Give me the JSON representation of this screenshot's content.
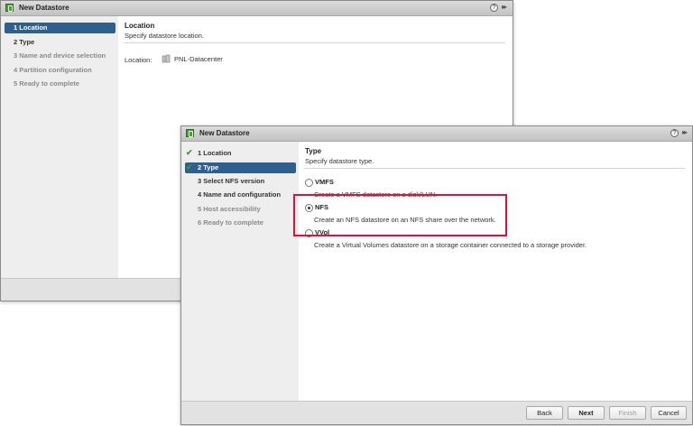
{
  "dialog_back": {
    "title": "New Datastore",
    "help": "?",
    "expand": "▸▸",
    "steps": [
      "1  Location",
      "2  Type",
      "3  Name and device selection",
      "4  Partition configuration",
      "5  Ready to complete"
    ],
    "section_title": "Location",
    "section_subtitle": "Specify datastore location.",
    "location_label": "Location:",
    "location_value": "PNL-Datacenter"
  },
  "dialog_front": {
    "title": "New Datastore",
    "help": "?",
    "expand": "▸▸",
    "check": "✔",
    "steps": [
      "1  Location",
      "2  Type",
      "3  Select NFS version",
      "4  Name and configuration",
      "5  Host accessibility",
      "6  Ready to complete"
    ],
    "section_title": "Type",
    "section_subtitle": "Specify datastore type.",
    "options": [
      {
        "label": "VMFS",
        "desc": "Create a VMFS datastore on a disk/LUN."
      },
      {
        "label": "NFS",
        "desc": "Create an NFS datastore on an NFS share over the network."
      },
      {
        "label": "VVol",
        "desc": "Create a Virtual Volumes datastore on a storage container connected to a storage provider."
      }
    ],
    "selected_option": "NFS",
    "buttons": {
      "back": "Back",
      "next": "Next",
      "finish": "Finish",
      "cancel": "Cancel"
    }
  },
  "colors": {
    "highlight": "#e3103c",
    "active_step": "#2f5f8f",
    "check": "#3d9a2b"
  }
}
